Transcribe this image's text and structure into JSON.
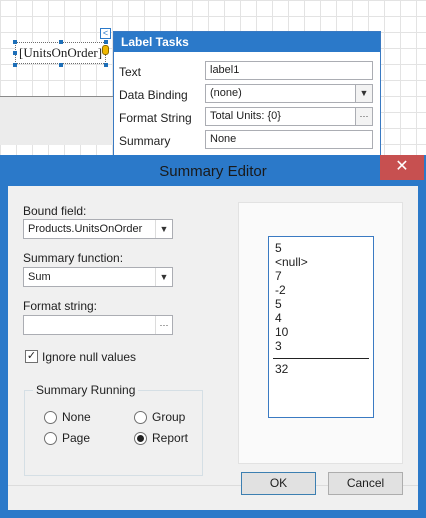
{
  "designer": {
    "label_text": "[UnitsOnOrder]",
    "smart_tag": "<"
  },
  "tasks": {
    "title": "Label Tasks",
    "rows": [
      {
        "label": "Text",
        "value": "label1",
        "control": "text"
      },
      {
        "label": "Data Binding",
        "value": "(none)",
        "control": "combo"
      },
      {
        "label": "Format String",
        "value": "Total Units: {0}",
        "control": "ellipsis"
      },
      {
        "label": "Summary",
        "value": "None",
        "control": "text"
      }
    ]
  },
  "dialog": {
    "title": "Summary Editor",
    "close_glyph": "✕",
    "bound_field_label": "Bound field:",
    "bound_field_value": "Products.UnitsOnOrder",
    "summary_function_label": "Summary function:",
    "summary_function_value": "Sum",
    "format_string_label": "Format string:",
    "format_string_value": "",
    "ellipsis": "···",
    "ignore_nulls_label": "Ignore null values",
    "ignore_nulls_checked": true,
    "summary_running": {
      "title": "Summary Running",
      "options": [
        {
          "label": "None",
          "selected": false
        },
        {
          "label": "Group",
          "selected": false
        },
        {
          "label": "Page",
          "selected": false
        },
        {
          "label": "Report",
          "selected": true
        }
      ]
    },
    "preview": {
      "values": [
        "5",
        "<null>",
        "7",
        "-2",
        "5",
        "4",
        "10",
        "3"
      ],
      "total": "32"
    },
    "ok_label": "OK",
    "cancel_label": "Cancel"
  }
}
